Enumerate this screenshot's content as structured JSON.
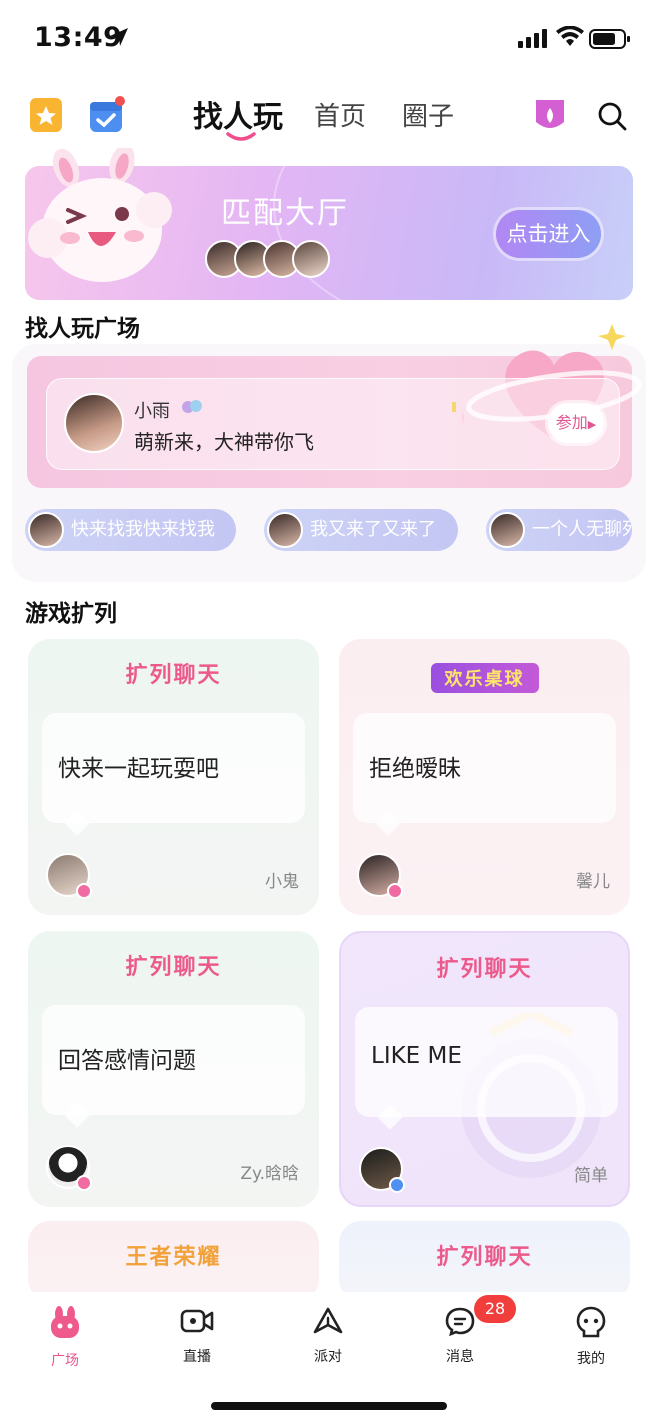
{
  "status_bar": {
    "time": "13:49"
  },
  "top_nav": {
    "tabs": [
      {
        "label": "找人玩",
        "active": true
      },
      {
        "label": "首页",
        "active": false
      },
      {
        "label": "圈子",
        "active": false
      }
    ]
  },
  "banner": {
    "title": "匹配大厅",
    "button_label": "点击进入"
  },
  "square": {
    "title": "找人玩广场",
    "post": {
      "name": "小雨",
      "text": "萌新来，大神带你飞",
      "join_label": "参加"
    },
    "chips": [
      "快来找我快来找我",
      "我又来了又来了",
      "一个人无聊死"
    ]
  },
  "games": {
    "title": "游戏扩列",
    "cards": [
      {
        "logo": "扩列聊天",
        "text": "快来一起玩耍吧",
        "user": "小鬼",
        "gender": "female"
      },
      {
        "logo": "欢乐桌球",
        "text": "拒绝暧昧",
        "user": "馨儿",
        "gender": "female"
      },
      {
        "logo": "扩列聊天",
        "text": "回答感情问题",
        "user": "Zy.晗晗",
        "gender": "female"
      },
      {
        "logo": "扩列聊天",
        "text": "LIKE ME",
        "user": "简单",
        "gender": "male"
      },
      {
        "logo": "王者荣耀"
      },
      {
        "logo": "扩列聊天"
      }
    ]
  },
  "tab_bar": {
    "items": [
      {
        "label": "广场",
        "active": true
      },
      {
        "label": "直播"
      },
      {
        "label": "派对"
      },
      {
        "label": "消息"
      },
      {
        "label": "我的"
      }
    ],
    "message_badge": "28"
  },
  "colors": {
    "accent": "#e9558d",
    "badge": "#f23d3d",
    "tab_logo": "#ec5a8c"
  }
}
